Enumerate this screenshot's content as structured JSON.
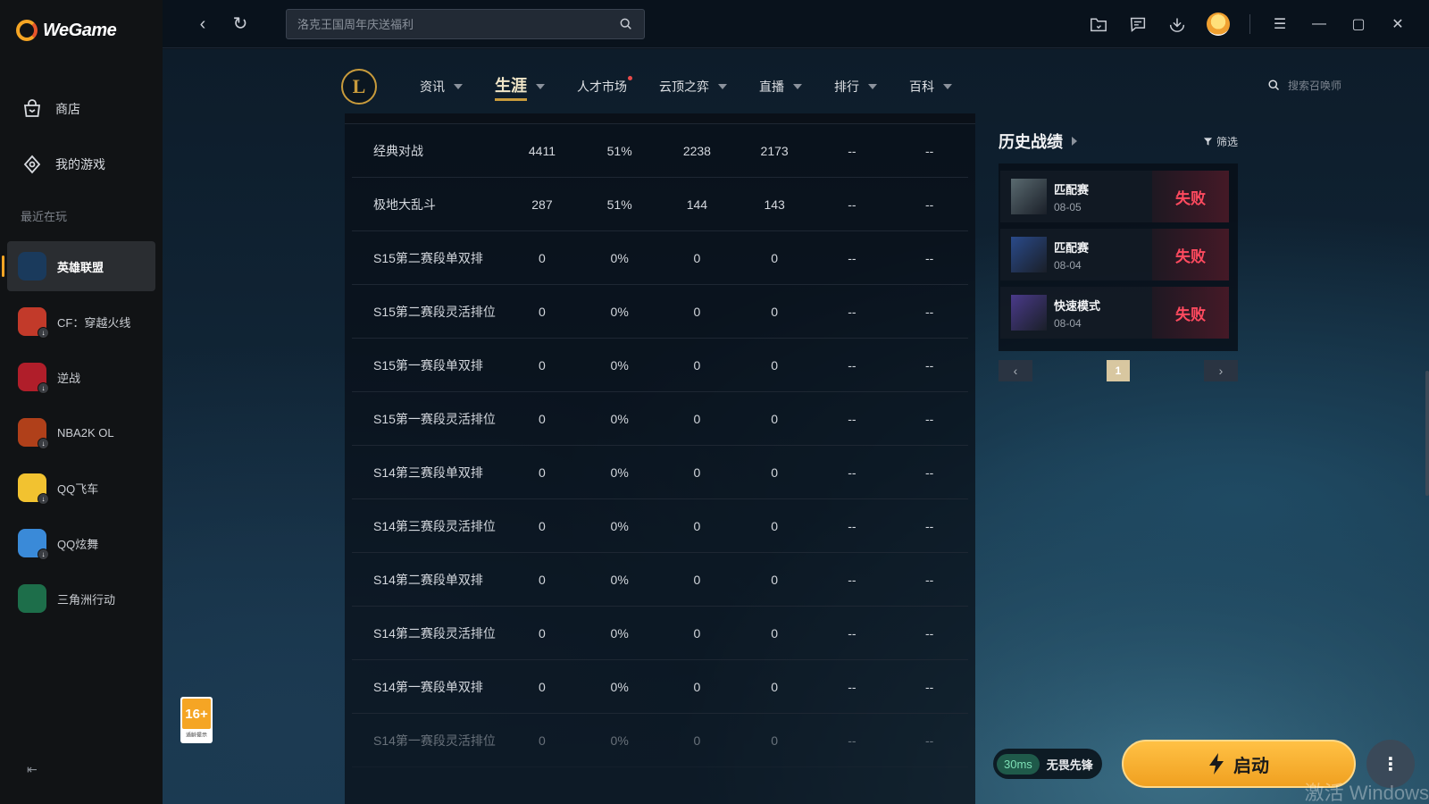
{
  "app": {
    "name": "WeGame"
  },
  "sidebar": {
    "store_label": "商店",
    "mygames_label": "我的游戏",
    "recent_label": "最近在玩",
    "games": [
      {
        "name": "英雄联盟",
        "active": true,
        "color": "#1a3a5c",
        "download": false
      },
      {
        "name": "CF：穿越火线",
        "active": false,
        "color": "#c23a2a",
        "download": true
      },
      {
        "name": "逆战",
        "active": false,
        "color": "#b01e2a",
        "download": true
      },
      {
        "name": "NBA2K OL",
        "active": false,
        "color": "#b0401a",
        "download": true
      },
      {
        "name": "QQ飞车",
        "active": false,
        "color": "#f2c230",
        "download": true
      },
      {
        "name": "QQ炫舞",
        "active": false,
        "color": "#3a8ad8",
        "download": true
      },
      {
        "name": "三角洲行动",
        "active": false,
        "color": "#1d6e4a",
        "download": false
      }
    ]
  },
  "topbar": {
    "search_placeholder": "洛克王国周年庆送福利"
  },
  "lol_nav": {
    "logo_letter": "L",
    "tabs": [
      {
        "label": "资讯",
        "active": false,
        "caret": true,
        "dot": false
      },
      {
        "label": "生涯",
        "active": true,
        "caret": true,
        "dot": false
      },
      {
        "label": "人才市场",
        "active": false,
        "caret": false,
        "dot": true
      },
      {
        "label": "云顶之弈",
        "active": false,
        "caret": true,
        "dot": false
      },
      {
        "label": "直播",
        "active": false,
        "caret": true,
        "dot": false
      },
      {
        "label": "排行",
        "active": false,
        "caret": true,
        "dot": false
      },
      {
        "label": "百科",
        "active": false,
        "caret": true,
        "dot": false
      }
    ],
    "summoner_search_placeholder": "搜索召唤师"
  },
  "stats": {
    "rows": [
      [
        "经典对战",
        "4411",
        "51%",
        "2238",
        "2173",
        "--",
        "--"
      ],
      [
        "极地大乱斗",
        "287",
        "51%",
        "144",
        "143",
        "--",
        "--"
      ],
      [
        "S15第二赛段单双排",
        "0",
        "0%",
        "0",
        "0",
        "--",
        "--"
      ],
      [
        "S15第二赛段灵活排位",
        "0",
        "0%",
        "0",
        "0",
        "--",
        "--"
      ],
      [
        "S15第一赛段单双排",
        "0",
        "0%",
        "0",
        "0",
        "--",
        "--"
      ],
      [
        "S15第一赛段灵活排位",
        "0",
        "0%",
        "0",
        "0",
        "--",
        "--"
      ],
      [
        "S14第三赛段单双排",
        "0",
        "0%",
        "0",
        "0",
        "--",
        "--"
      ],
      [
        "S14第三赛段灵活排位",
        "0",
        "0%",
        "0",
        "0",
        "--",
        "--"
      ],
      [
        "S14第二赛段单双排",
        "0",
        "0%",
        "0",
        "0",
        "--",
        "--"
      ],
      [
        "S14第二赛段灵活排位",
        "0",
        "0%",
        "0",
        "0",
        "--",
        "--"
      ],
      [
        "S14第一赛段单双排",
        "0",
        "0%",
        "0",
        "0",
        "--",
        "--"
      ],
      [
        "S14第一赛段灵活排位",
        "0",
        "0%",
        "0",
        "0",
        "--",
        "--"
      ]
    ]
  },
  "history": {
    "title": "历史战绩",
    "filter_label": "筛选",
    "matches": [
      {
        "mode": "匹配赛",
        "date": "08-05",
        "result": "失败",
        "champ_color": "#5a6a70"
      },
      {
        "mode": "匹配赛",
        "date": "08-04",
        "result": "失败",
        "champ_color": "#2a4a8a"
      },
      {
        "mode": "快速模式",
        "date": "08-04",
        "result": "失败",
        "champ_color": "#4a3a8a"
      }
    ],
    "page": "1"
  },
  "age_rating": {
    "label": "16+",
    "note": "适龄提示"
  },
  "bottom": {
    "ping": "30ms",
    "accelerator_label": "无畏先锋",
    "launch_label": "启动"
  },
  "watermark": "激活 Windows"
}
